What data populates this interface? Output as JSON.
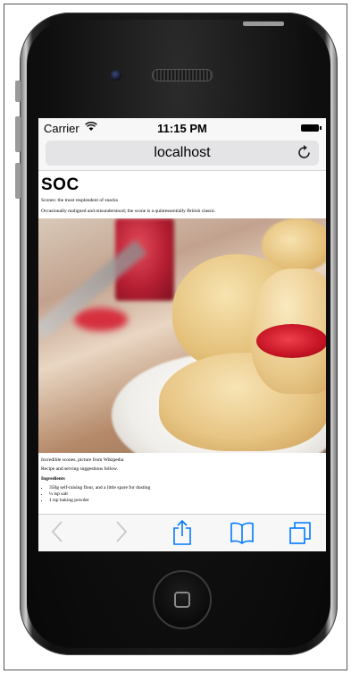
{
  "status_bar": {
    "carrier": "Carrier",
    "time": "11:15 PM",
    "wifi_icon": "wifi-icon",
    "battery_icon": "battery-icon"
  },
  "browser": {
    "url": "localhost",
    "reload_icon": "reload-icon"
  },
  "page": {
    "title": "SOC",
    "subtitle": "Scones: the most resplendent of snacks",
    "intro": "Occasionally maligned and misunderstood; the scone is a quintessentially British classic.",
    "image_caption": "Incredible scones, picture from Wikipedia",
    "recipe_intro": "Recipe and serving suggestions follow.",
    "ingredients_heading": "Ingredients",
    "ingredients": [
      "350g self-raising flour, and a little spare for dusting",
      "¼ tsp salt",
      "1 tsp baking powder"
    ]
  },
  "toolbar": {
    "back_icon": "back-icon",
    "forward_icon": "forward-icon",
    "share_icon": "share-icon",
    "bookmarks_icon": "bookmarks-icon",
    "tabs_icon": "tabs-icon"
  },
  "colors": {
    "toolbar_tint": "#007aff",
    "disabled_tint": "#c7c7cc",
    "bar_background": "#f7f7f7"
  }
}
